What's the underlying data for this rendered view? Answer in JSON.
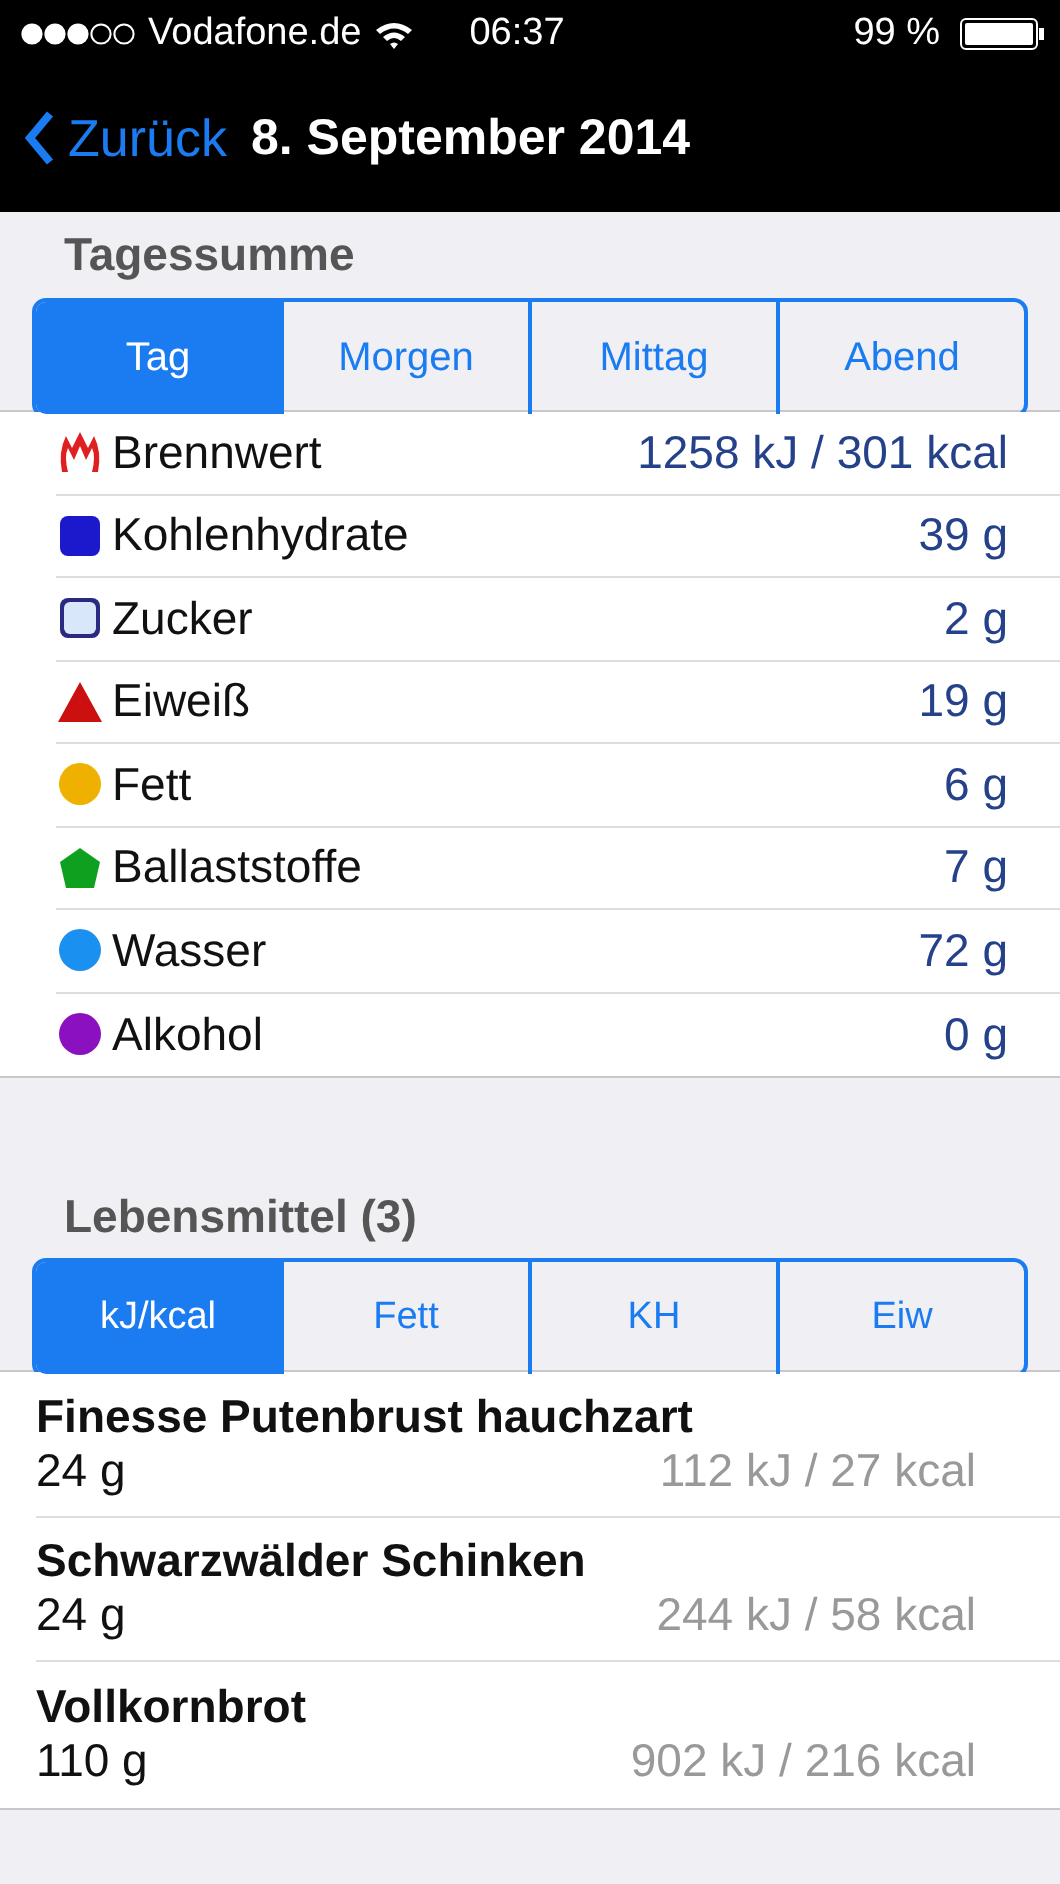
{
  "status_bar": {
    "carrier": "Vodafone.de",
    "time": "06:37",
    "battery": "99 %"
  },
  "nav": {
    "back": "Zurück",
    "title": "8. September 2014"
  },
  "summary": {
    "title": "Tagessumme",
    "tabs": [
      {
        "label": "Tag",
        "selected": true
      },
      {
        "label": "Morgen",
        "selected": false
      },
      {
        "label": "Mittag",
        "selected": false
      },
      {
        "label": "Abend",
        "selected": false
      }
    ],
    "rows": [
      {
        "kind": "flame",
        "color": "#e02020",
        "name": "Brennwert",
        "value": "1258 kJ / 301 kcal"
      },
      {
        "kind": "square",
        "color": "#1a1acc",
        "name": "Kohlenhydrate",
        "value": "39 g"
      },
      {
        "kind": "outline",
        "color": "#2a2a80",
        "name": "Zucker",
        "value": "2 g"
      },
      {
        "kind": "triangle",
        "color": "#cc1010",
        "name": "Eiweiß",
        "value": "19 g"
      },
      {
        "kind": "circle",
        "color": "#f0b000",
        "name": "Fett",
        "value": "6 g"
      },
      {
        "kind": "pentagon",
        "color": "#10a020",
        "name": "Ballaststoffe",
        "value": "7 g"
      },
      {
        "kind": "circle",
        "color": "#1a90f0",
        "name": "Wasser",
        "value": "72 g"
      },
      {
        "kind": "circle",
        "color": "#8a10c0",
        "name": "Alkohol",
        "value": "0 g"
      }
    ]
  },
  "foods": {
    "title": "Lebensmittel (3)",
    "tabs": [
      {
        "label": "kJ/kcal",
        "selected": true
      },
      {
        "label": "Fett",
        "selected": false
      },
      {
        "label": "KH",
        "selected": false
      },
      {
        "label": "Eiw",
        "selected": false
      }
    ],
    "rows": [
      {
        "name": "Finesse Putenbrust hauchzart",
        "amount": "24 g",
        "energy": "112 kJ / 27 kcal"
      },
      {
        "name": "Schwarzwälder Schinken",
        "amount": "24 g",
        "energy": "244 kJ / 58 kcal"
      },
      {
        "name": "Vollkornbrot",
        "amount": "110 g",
        "energy": "902 kJ / 216 kcal"
      }
    ]
  }
}
